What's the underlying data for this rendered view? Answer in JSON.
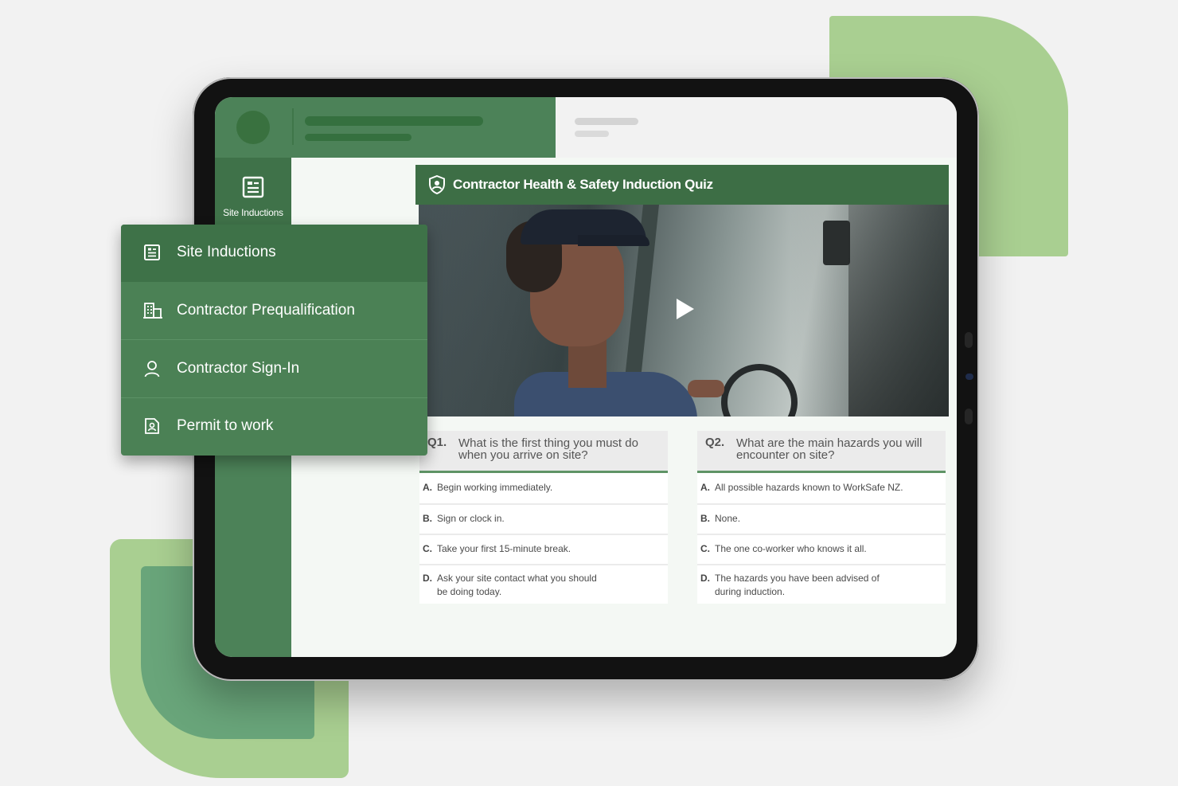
{
  "colors": {
    "primary_green": "#4c8258",
    "dark_green": "#3d6e45",
    "leaf_light": "#a9cf91",
    "leaf_mid": "#69a57a"
  },
  "sidebar": {
    "items": [
      {
        "label": "Site Inductions",
        "icon": "document-list-icon"
      }
    ]
  },
  "quiz": {
    "title": "Contractor Health & Safety Induction Quiz",
    "title_icon": "shield-user-icon",
    "video": {
      "icon": "play-icon"
    },
    "questions": [
      {
        "number": "Q1.",
        "text": "What is the first thing you must do when you arrive on site?",
        "options": [
          {
            "letter": "A.",
            "text": "Begin working immediately."
          },
          {
            "letter": "B.",
            "text": "Sign or clock in."
          },
          {
            "letter": "C.",
            "text": "Take your first 15-minute break."
          },
          {
            "letter": "D.",
            "text": "Ask your site contact what you should be doing today."
          }
        ]
      },
      {
        "number": "Q2.",
        "text": "What are the main hazards you will encounter on site?",
        "options": [
          {
            "letter": "A.",
            "text": "All possible hazards known to WorkSafe NZ."
          },
          {
            "letter": "B.",
            "text": "None."
          },
          {
            "letter": "C.",
            "text": "The one co-worker who knows it all."
          },
          {
            "letter": "D.",
            "text": "The hazards you have been advised of during induction."
          }
        ]
      }
    ]
  },
  "menu": {
    "items": [
      {
        "label": "Site Inductions",
        "icon": "document-list-icon",
        "selected": true
      },
      {
        "label": "Contractor Prequalification",
        "icon": "building-icon"
      },
      {
        "label": "Contractor Sign-In",
        "icon": "user-icon"
      },
      {
        "label": "Permit to work",
        "icon": "permit-icon"
      }
    ]
  }
}
